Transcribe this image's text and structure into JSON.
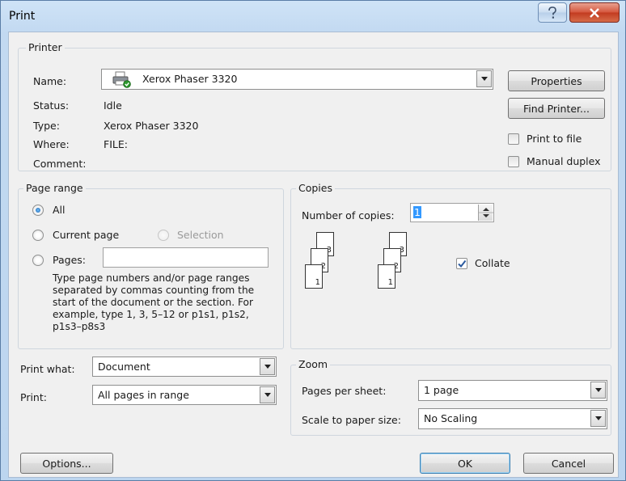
{
  "window": {
    "title": "Print"
  },
  "printer": {
    "group_label": "Printer",
    "name_label": "Name:",
    "name_value": "Xerox Phaser 3320",
    "status_label": "Status:",
    "status_value": "Idle",
    "type_label": "Type:",
    "type_value": "Xerox Phaser 3320",
    "where_label": "Where:",
    "where_value": "FILE:",
    "comment_label": "Comment:",
    "properties_button": "Properties",
    "find_printer_button": "Find Printer...",
    "print_to_file_label": "Print to file",
    "print_to_file_checked": false,
    "manual_duplex_label": "Manual duplex",
    "manual_duplex_checked": false
  },
  "page_range": {
    "group_label": "Page range",
    "all_label": "All",
    "current_page_label": "Current page",
    "selection_label": "Selection",
    "pages_label": "Pages:",
    "pages_value": "",
    "selected": "All",
    "help_text": "Type page numbers and/or page ranges separated by commas counting from the start of the document or the section. For example, type 1, 3, 5–12 or p1s1, p1s2, p1s3–p8s3"
  },
  "copies": {
    "group_label": "Copies",
    "number_label": "Number of copies:",
    "number_value": "1",
    "collate_label": "Collate",
    "collate_checked": true,
    "page_numbers": [
      "3",
      "2",
      "1"
    ]
  },
  "print_what": {
    "label": "Print what:",
    "value": "Document"
  },
  "print": {
    "label": "Print:",
    "value": "All pages in range"
  },
  "zoom": {
    "group_label": "Zoom",
    "pages_per_sheet_label": "Pages per sheet:",
    "pages_per_sheet_value": "1 page",
    "scale_label": "Scale to paper size:",
    "scale_value": "No Scaling"
  },
  "footer": {
    "options_button": "Options...",
    "ok_button": "OK",
    "cancel_button": "Cancel"
  }
}
